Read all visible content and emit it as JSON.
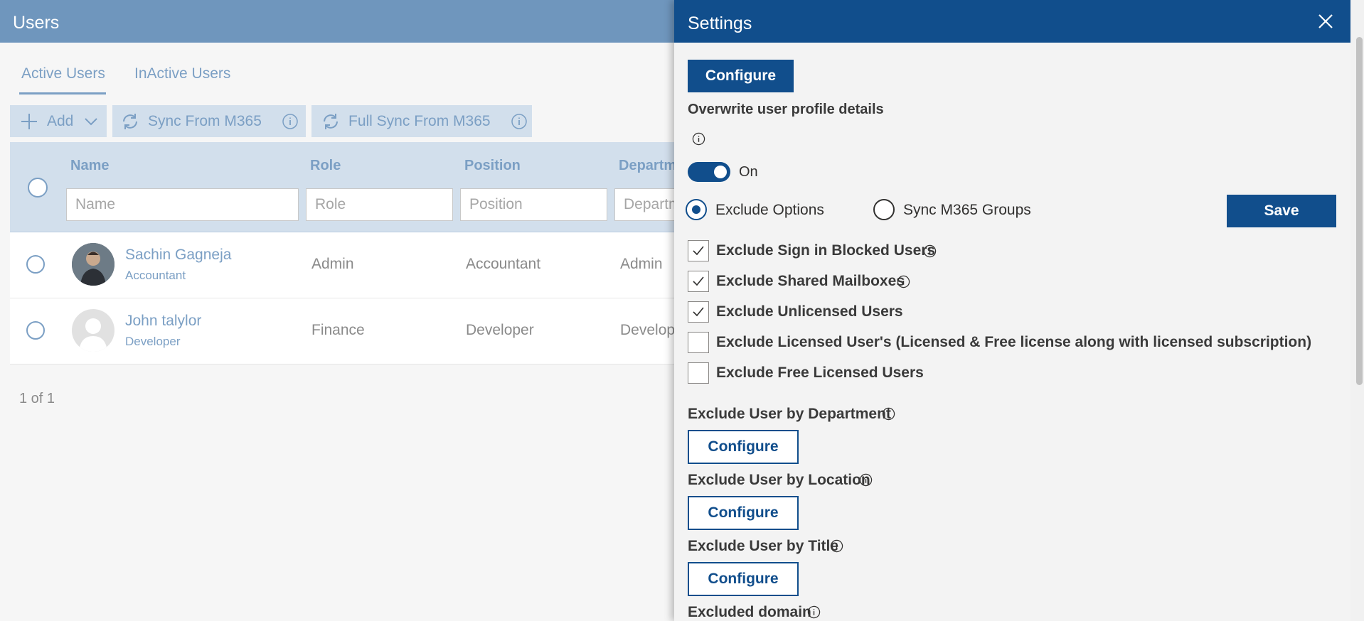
{
  "page": {
    "title": "Users"
  },
  "tabs": [
    {
      "label": "Active Users",
      "active": true
    },
    {
      "label": "InActive Users",
      "active": false
    }
  ],
  "toolbar": {
    "add_label": "Add",
    "sync_label": "Sync From M365",
    "full_sync_label": "Full Sync From M365"
  },
  "grid": {
    "columns": [
      "Name",
      "Role",
      "Position",
      "Departm"
    ],
    "filters": [
      "Name",
      "Role",
      "Position",
      "Departm"
    ],
    "rows": [
      {
        "name": "Sachin Gagneja",
        "subtitle": "Accountant",
        "role": "Admin",
        "position": "Accountant",
        "department": "Admin",
        "avatar": "photo"
      },
      {
        "name": "John talylor",
        "subtitle": "Developer",
        "role": "Finance",
        "position": "Developer",
        "department": "Develop",
        "avatar": "placeholder-person-icon"
      }
    ],
    "pager": "1 of 1"
  },
  "settings": {
    "title": "Settings",
    "configure_top": "Configure",
    "overwrite_label": "Overwrite user profile details",
    "toggle_state": "On",
    "radio_options": [
      {
        "label": "Exclude Options",
        "selected": true
      },
      {
        "label": "Sync M365 Groups",
        "selected": false
      }
    ],
    "save_label": "Save",
    "checkboxes": [
      {
        "label": "Exclude Sign in Blocked Users",
        "checked": true,
        "info": true
      },
      {
        "label": "Exclude Shared Mailboxes",
        "checked": true,
        "info": true
      },
      {
        "label": "Exclude Unlicensed Users",
        "checked": true,
        "info": false
      },
      {
        "label": "Exclude Licensed User's (Licensed & Free license along with licensed subscription)",
        "checked": false,
        "info": false
      },
      {
        "label": "Exclude Free Licensed Users",
        "checked": false,
        "info": false
      }
    ],
    "sections": [
      {
        "label": "Exclude User by Department",
        "button": "Configure"
      },
      {
        "label": "Exclude User by Location",
        "button": "Configure"
      },
      {
        "label": "Exclude User by Title",
        "button": "Configure"
      }
    ],
    "excluded_domain_label": "Excluded domain"
  },
  "colors": {
    "header_blue": "#114e8c",
    "faded_blue": "#6f96bd",
    "link_blue": "#7b9fc4"
  }
}
